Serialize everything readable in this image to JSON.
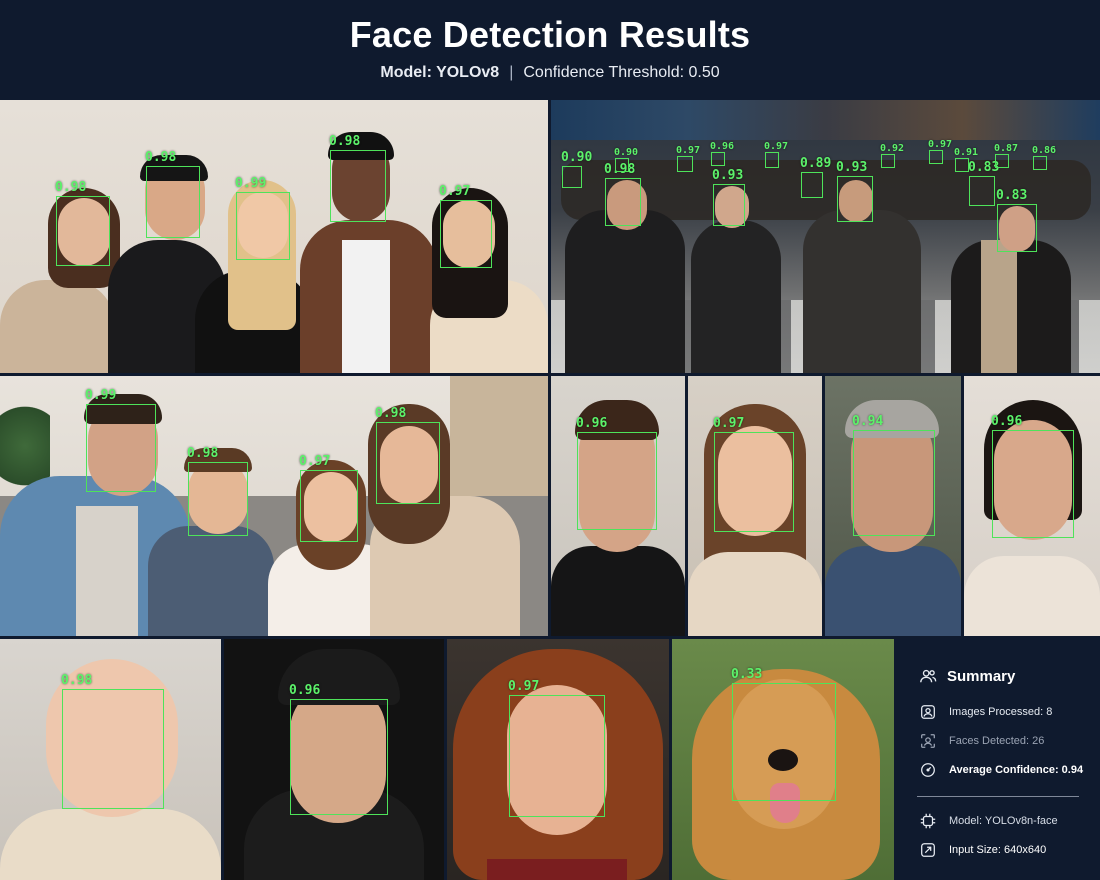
{
  "header": {
    "title": "Face Detection Results",
    "model_label": "Model: YOLOv8",
    "separator": "|",
    "threshold_label": "Confidence Threshold: 0.50"
  },
  "panels": {
    "group_five": {
      "scores": [
        "0.98",
        "0.98",
        "0.99",
        "0.98",
        "0.97"
      ]
    },
    "crowd": {
      "scores": [
        "0.90",
        "0.98",
        "0.93",
        "0.89",
        "0.93",
        "0.83",
        "0.83"
      ],
      "small_scores": [
        "0.90",
        "0.97",
        "0.96",
        "0.97",
        "0.92",
        "0.97",
        "0.91",
        "0.87",
        "0.86"
      ]
    },
    "family": {
      "scores": [
        "0.99",
        "0.98",
        "0.97",
        "0.98"
      ]
    },
    "portrait_man": {
      "score": "0.96"
    },
    "portrait_woman": {
      "score": "0.97"
    },
    "portrait_elder": {
      "score": "0.94"
    },
    "portrait_woman2": {
      "score": "0.96"
    },
    "baby": {
      "score": "0.98"
    },
    "cap_man": {
      "score": "0.96"
    },
    "curly_woman": {
      "score": "0.97"
    },
    "dog": {
      "score": "0.33"
    }
  },
  "summary": {
    "title": "Summary",
    "images_processed": "Images Processed: 8",
    "faces_detected": "Faces Detected: 26",
    "average_confidence": "Average Confidence: 0.94",
    "model": "Model: YOLOv8n-face",
    "input_size": "Input Size: 640x640"
  },
  "colors": {
    "header_bg": "#0f1a2e",
    "box_green": "#4ee35a",
    "summary_bg": "#0f1a2e"
  },
  "icons": {
    "summary": "users-icon",
    "images": "image-stack-icon",
    "faces": "face-scan-icon",
    "confidence": "gauge-icon",
    "model": "chip-icon",
    "input": "resize-icon"
  }
}
